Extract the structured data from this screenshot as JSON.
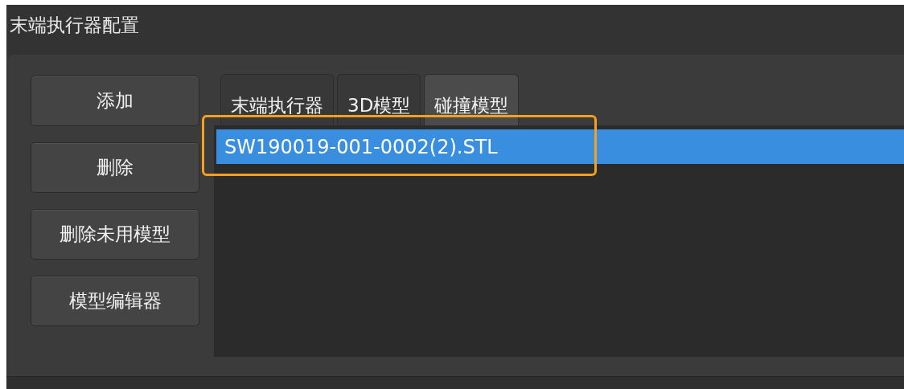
{
  "window": {
    "title": "末端执行器配置"
  },
  "buttons": [
    "添加",
    "删除",
    "删除未用模型",
    "模型编辑器"
  ],
  "tabs": [
    {
      "label": "末端执行器",
      "selected": false
    },
    {
      "label": "3D模型",
      "selected": false
    },
    {
      "label": "碰撞模型",
      "selected": true
    }
  ],
  "list": {
    "items": [
      {
        "label": "SW190019-001-0002(2).STL",
        "selected": true
      }
    ]
  }
}
